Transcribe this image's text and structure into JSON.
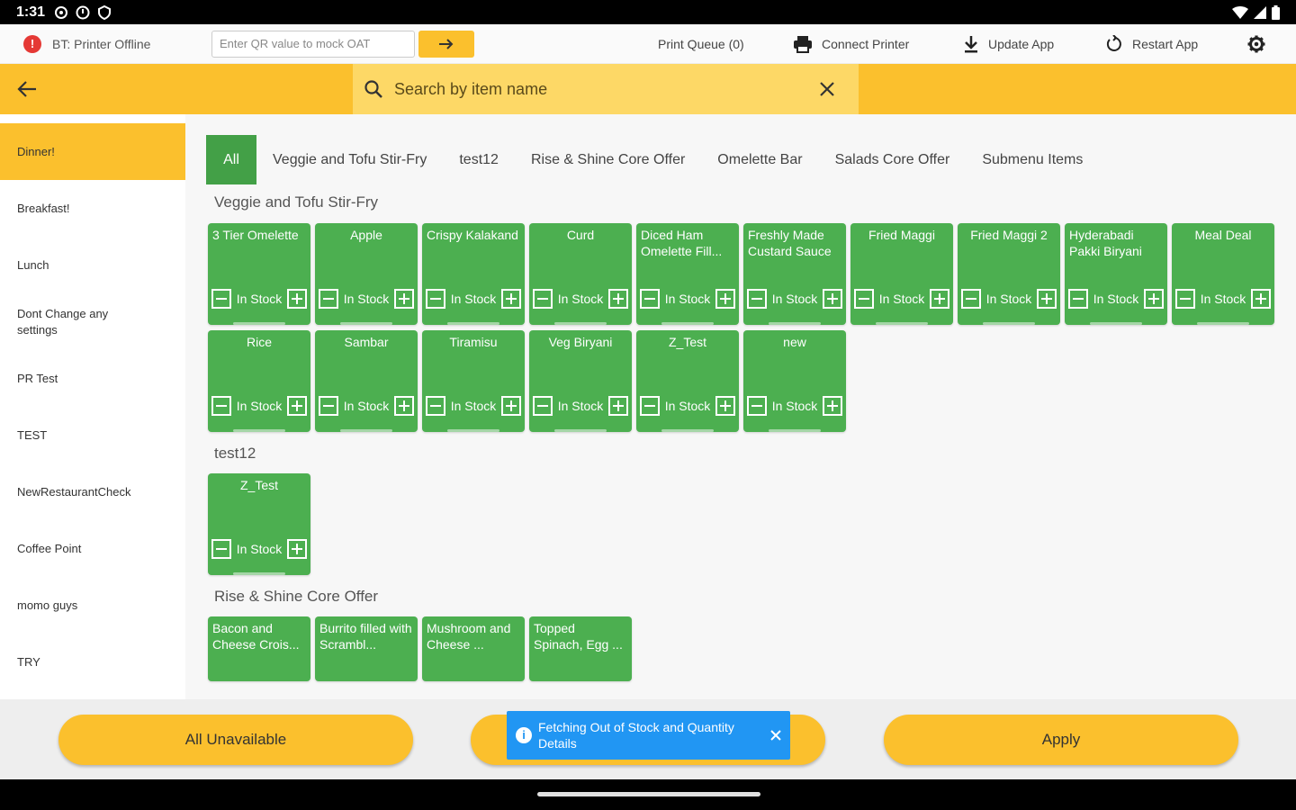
{
  "status_bar": {
    "time": "1:31"
  },
  "toolbar": {
    "printer_badge": "!",
    "printer_status": "BT: Printer Offline",
    "qr_placeholder": "Enter QR value to mock OAT",
    "print_queue": "Print Queue (0)",
    "connect_printer": "Connect Printer",
    "update_app": "Update App",
    "restart_app": "Restart App"
  },
  "search": {
    "placeholder": "Search by item name"
  },
  "sidebar": {
    "items": [
      {
        "label": "Dinner!"
      },
      {
        "label": "Breakfast!"
      },
      {
        "label": "Lunch"
      },
      {
        "label": "Dont Change any settings"
      },
      {
        "label": "PR Test"
      },
      {
        "label": "TEST"
      },
      {
        "label": "NewRestaurantCheck"
      },
      {
        "label": "Coffee Point"
      },
      {
        "label": "momo guys"
      },
      {
        "label": "TRY"
      }
    ]
  },
  "tabs": [
    {
      "label": "All"
    },
    {
      "label": "Veggie and Tofu Stir-Fry"
    },
    {
      "label": "test12"
    },
    {
      "label": "Rise & Shine Core Offer"
    },
    {
      "label": "Omelette Bar"
    },
    {
      "label": "Salads Core Offer"
    },
    {
      "label": "Submenu Items"
    }
  ],
  "stock_label": "In Stock",
  "sections": [
    {
      "title": "Veggie and Tofu Stir-Fry",
      "items": [
        {
          "name": "3 Tier Omelette",
          "align": "left"
        },
        {
          "name": "Apple",
          "align": "center"
        },
        {
          "name": "Crispy Kalakand",
          "align": "left"
        },
        {
          "name": "Curd",
          "align": "center"
        },
        {
          "name": "Diced Ham Omelette Fill...",
          "align": "left"
        },
        {
          "name": "Freshly Made Custard Sauce",
          "align": "left"
        },
        {
          "name": "Fried Maggi",
          "align": "center"
        },
        {
          "name": "Fried Maggi 2",
          "align": "center"
        },
        {
          "name": "Hyderabadi Pakki Biryani",
          "align": "left"
        },
        {
          "name": "Meal Deal",
          "align": "center"
        },
        {
          "name": "Rice",
          "align": "center"
        },
        {
          "name": "Sambar",
          "align": "center"
        },
        {
          "name": "Tiramisu",
          "align": "center"
        },
        {
          "name": "Veg Biryani",
          "align": "center"
        },
        {
          "name": "Z_Test",
          "align": "center"
        },
        {
          "name": "new",
          "align": "center"
        }
      ]
    },
    {
      "title": "test12",
      "items": [
        {
          "name": "Z_Test",
          "align": "center"
        }
      ]
    },
    {
      "title": "Rise & Shine Core Offer",
      "items": [
        {
          "name": "Bacon and Cheese Crois...",
          "align": "left"
        },
        {
          "name": "Burrito filled with Scrambl...",
          "align": "left"
        },
        {
          "name": "Mushroom and Cheese ...",
          "align": "left"
        },
        {
          "name": "Topped Spinach, Egg ...",
          "align": "left"
        }
      ]
    }
  ],
  "actions": {
    "all_unavailable": "All Unavailable",
    "apply": "Apply"
  },
  "toast": {
    "message": "Fetching Out of Stock and Quantity Details"
  },
  "colors": {
    "accent": "#fbc02d",
    "card": "#4caf50",
    "toast": "#2196f3"
  }
}
